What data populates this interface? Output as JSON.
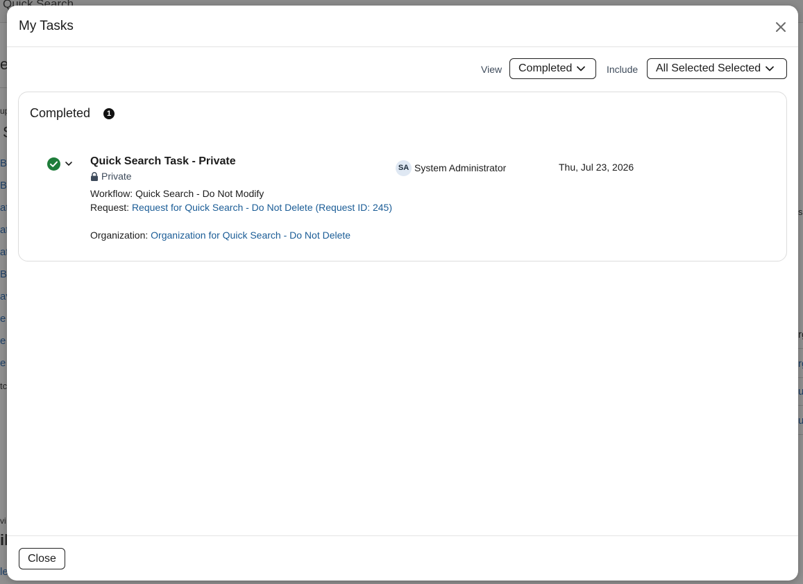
{
  "background": {
    "title": "Quick Search",
    "left_fragments": [
      "e",
      "up",
      "S",
      "B",
      "B",
      "at",
      "at",
      "at",
      "Ba",
      "av",
      "e",
      "e",
      "e",
      "tc",
      "vi",
      "il",
      "le"
    ],
    "right_fragments": [
      "sp",
      "rg",
      "rg",
      "u",
      "u"
    ]
  },
  "modal": {
    "title": "My Tasks",
    "close_icon": "close-icon",
    "toolbar": {
      "view_label": "View",
      "view_value": "Completed",
      "include_label": "Include",
      "include_value": "All Selected Selected"
    },
    "section": {
      "title": "Completed",
      "count": "1",
      "tasks": [
        {
          "status_icon": "check-circle-icon",
          "title": "Quick Search Task - Private",
          "privacy": "Private",
          "workflow_label": "Workflow:",
          "workflow_value": "Quick Search - Do Not Modify",
          "request_label": "Request:",
          "request_link": "Request for Quick Search - Do Not Delete (Request ID: 245)",
          "organization_label": "Organization:",
          "organization_link": "Organization for Quick Search - Do Not Delete",
          "assignee_initials": "SA",
          "assignee_name": "System Administrator",
          "date": "Thu, Jul 23, 2026"
        }
      ]
    },
    "footer": {
      "close_label": "Close"
    },
    "colors": {
      "accent_link": "#1a5c96",
      "success": "#1e7d3a",
      "badge": "#111111"
    }
  }
}
